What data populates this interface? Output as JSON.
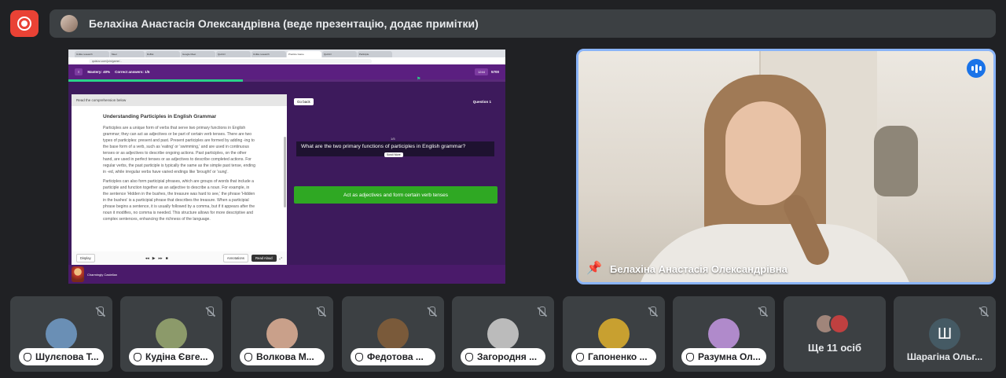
{
  "presenter": {
    "banner_text": "Белахіна Анастасія Олександрівна (веде презентацію, додає примітки)"
  },
  "shared_screen": {
    "tabs": [
      "Unlike research",
      "Meet",
      "DuBut",
      "Google Meet",
      "Quizizz",
      "Unlike research",
      "Practice Game",
      "Quizizz",
      "Participle"
    ],
    "url": "quizizz.com/join/game/...",
    "mastery": "Mastery: 40%",
    "correct_answers": "Correct answers: 1/5",
    "score": "1244",
    "score_max": "5700",
    "read_label": "Read the comprehension below",
    "passage_title": "Understanding Participles in English Grammar",
    "passage_p1": "Participles are a unique form of verbs that serve two primary functions in English grammar; they can act as adjectives or be part of certain verb tenses. There are two types of participles: present and past. Present participles are formed by adding -ing to the base form of a verb, such as 'eating' or 'swimming,' and are used in continuous tenses or as adjectives to describe ongoing actions. Past participles, on the other hand, are used in perfect tenses or as adjectives to describe completed actions. For regular verbs, the past participle is typically the same as the simple past tense, ending in -ed, while irregular verbs have varied endings like 'brought' or 'sung'.",
    "passage_p2": "Participles can also form participial phrases, which are groups of words that include a participle and function together as an adjective to describe a noun. For example, in the sentence 'Hidden in the bushes, the treasure was hard to see,' the phrase 'Hidden in the bushes' is a participial phrase that describes the treasure. When a participial phrase begins a sentence, it is usually followed by a comma, but if it appears after the noun it modifies, no comma is needed. This structure allows for more descriptive and complex sentences, enhancing the richness of the language.",
    "display_label": "Display",
    "annotations_label": "Annotations",
    "read_aloud_label": "Read Aloud",
    "go_back_label": "Go back",
    "question_label": "Question 1",
    "question_count": "1/5",
    "question_text": "What are the two primary functions of participles in English grammar?",
    "sound_label": "Scroll More",
    "answer_text": "Act as adjectives and form certain verb tenses",
    "character_name": "Charmingly Castellan"
  },
  "speaker": {
    "name": "Белахіна Анастасія Олександрівна"
  },
  "participants": [
    {
      "name": "Шулєпова Т...",
      "avatar_color": "#6a8fb5"
    },
    {
      "name": "Кудіна Євге...",
      "avatar_color": "#8c9a6a"
    },
    {
      "name": "Волкова М...",
      "avatar_color": "#c9a08a"
    },
    {
      "name": "Федотова ...",
      "avatar_color": "#7a5a3a"
    },
    {
      "name": "Загородня ...",
      "avatar_color": "#bbbbbb"
    },
    {
      "name": "Гапоненко ...",
      "avatar_color": "#c8a030"
    },
    {
      "name": "Разумна Ол...",
      "avatar_color": "#b08acb"
    }
  ],
  "more_participants": "Ще 11 осіб",
  "last_participant": {
    "initial": "Ш",
    "name": "Шарагіна Ольг..."
  },
  "colors": {
    "accent_blue": "#8ab4f8",
    "stop_red": "#e94235",
    "answer_green": "#2fa823",
    "game_purple": "#5b1f80"
  }
}
